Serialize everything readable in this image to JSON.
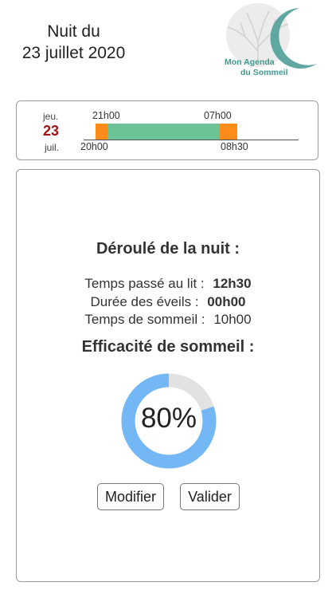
{
  "header": {
    "title_line1": "Nuit du",
    "title_line2": "23 juillet 2020",
    "logo_line1": "Mon Agenda",
    "logo_line2": "du Sommeil"
  },
  "timeline": {
    "day_name": "jeu.",
    "day_number": "23",
    "month": "juil.",
    "bed_time": "20h00",
    "sleep_start": "21h00",
    "wake_time": "07h00",
    "get_up_time": "08h30",
    "colors": {
      "awake": "#ff8c1a",
      "asleep": "#6cc496"
    }
  },
  "summary": {
    "heading": "Déroulé de la nuit :",
    "time_in_bed_label": "Temps passé au lit :",
    "time_in_bed_value": "12h30",
    "wake_duration_label": "Durée des éveils :",
    "wake_duration_value": "00h00",
    "sleep_time_label": "Temps de sommeil :",
    "sleep_time_value": "10h00",
    "efficiency_heading": "Efficacité de sommeil :",
    "efficiency_text": "80%",
    "efficiency_fraction": 0.8,
    "colors": {
      "filled": "#74b7f5",
      "empty": "#e2e2e2"
    }
  },
  "actions": {
    "modify_label": "Modifier",
    "validate_label": "Valider"
  }
}
